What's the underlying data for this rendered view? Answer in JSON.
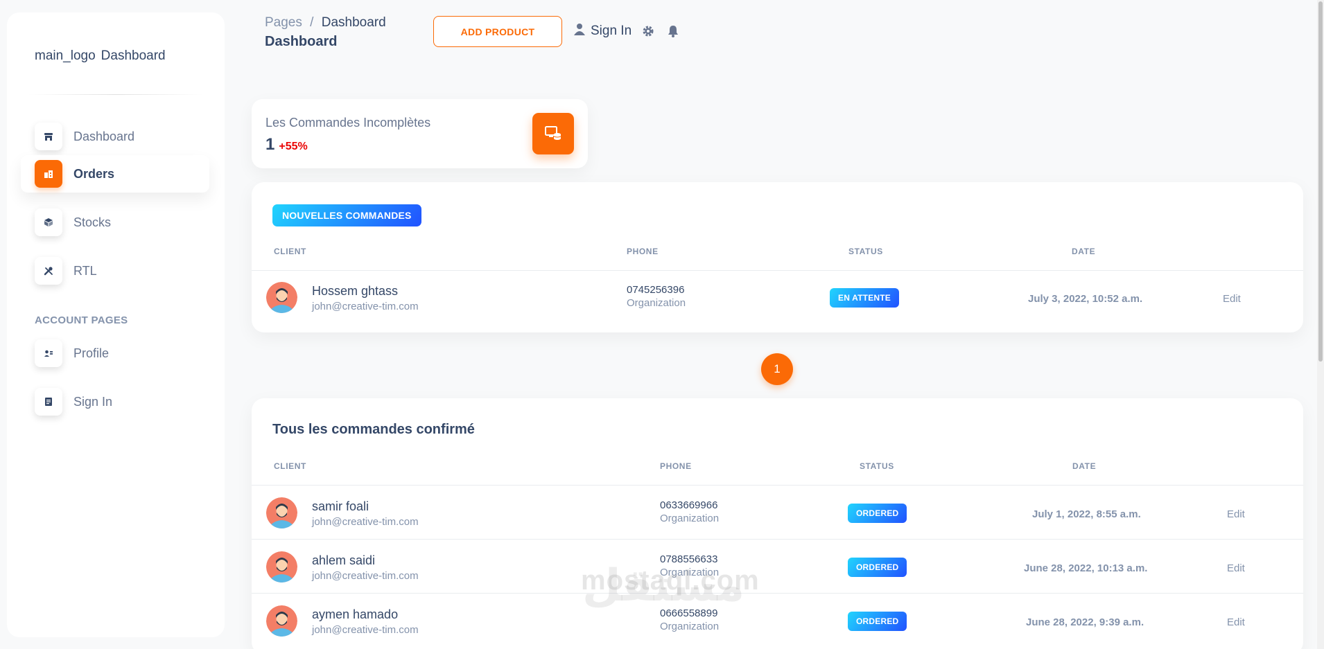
{
  "sidebar": {
    "logo_alt": "main_logo",
    "brand": "Dashboard",
    "items": [
      {
        "label": "Dashboard",
        "icon": "shop-icon"
      },
      {
        "label": "Orders",
        "icon": "office-icon"
      },
      {
        "label": "Stocks",
        "icon": "box-icon"
      },
      {
        "label": "RTL",
        "icon": "tools-icon"
      }
    ],
    "section_title": "ACCOUNT PAGES",
    "account_items": [
      {
        "label": "Profile",
        "icon": "profile-icon"
      },
      {
        "label": "Sign In",
        "icon": "document-icon"
      }
    ]
  },
  "header": {
    "breadcrumb_root": "Pages",
    "breadcrumb_sep": "/",
    "breadcrumb_current": "Dashboard",
    "title": "Dashboard",
    "add_product": "ADD PRODUCT",
    "sign_in": "Sign In"
  },
  "stat": {
    "label": "Les Commandes Incomplètes",
    "value": "1",
    "change": "+55%"
  },
  "new_orders": {
    "badge": "NOUVELLES COMMANDES",
    "columns": [
      "CLIENT",
      "PHONE",
      "STATUS",
      "DATE"
    ],
    "rows": [
      {
        "name": "Hossem ghtass",
        "email": "john@creative-tim.com",
        "phone": "0745256396",
        "org": "Organization",
        "status": "EN ATTENTE",
        "date": "July 3, 2022, 10:52 a.m.",
        "action": "Edit"
      }
    ]
  },
  "pagination": {
    "current": "1"
  },
  "confirmed_orders": {
    "title": "Tous les commandes confirmé",
    "columns": [
      "CLIENT",
      "PHONE",
      "STATUS",
      "DATE"
    ],
    "rows": [
      {
        "name": "samir foali",
        "email": "john@creative-tim.com",
        "phone": "0633669966",
        "org": "Organization",
        "status": "ORDERED",
        "date": "July 1, 2022, 8:55 a.m.",
        "action": "Edit"
      },
      {
        "name": "ahlem saidi",
        "email": "john@creative-tim.com",
        "phone": "0788556633",
        "org": "Organization",
        "status": "ORDERED",
        "date": "June 28, 2022, 10:13 a.m.",
        "action": "Edit"
      },
      {
        "name": "aymen hamado",
        "email": "john@creative-tim.com",
        "phone": "0666558899",
        "org": "Organization",
        "status": "ORDERED",
        "date": "June 28, 2022, 9:39 a.m.",
        "action": "Edit"
      }
    ]
  },
  "watermark": {
    "latin": "mostaql.com",
    "arabic": "مستقل"
  },
  "colors": {
    "accent": "#fb6a06",
    "badge_from": "#2152ff",
    "badge_to": "#21d4fd",
    "text": "#344767",
    "muted": "#8392ab"
  }
}
